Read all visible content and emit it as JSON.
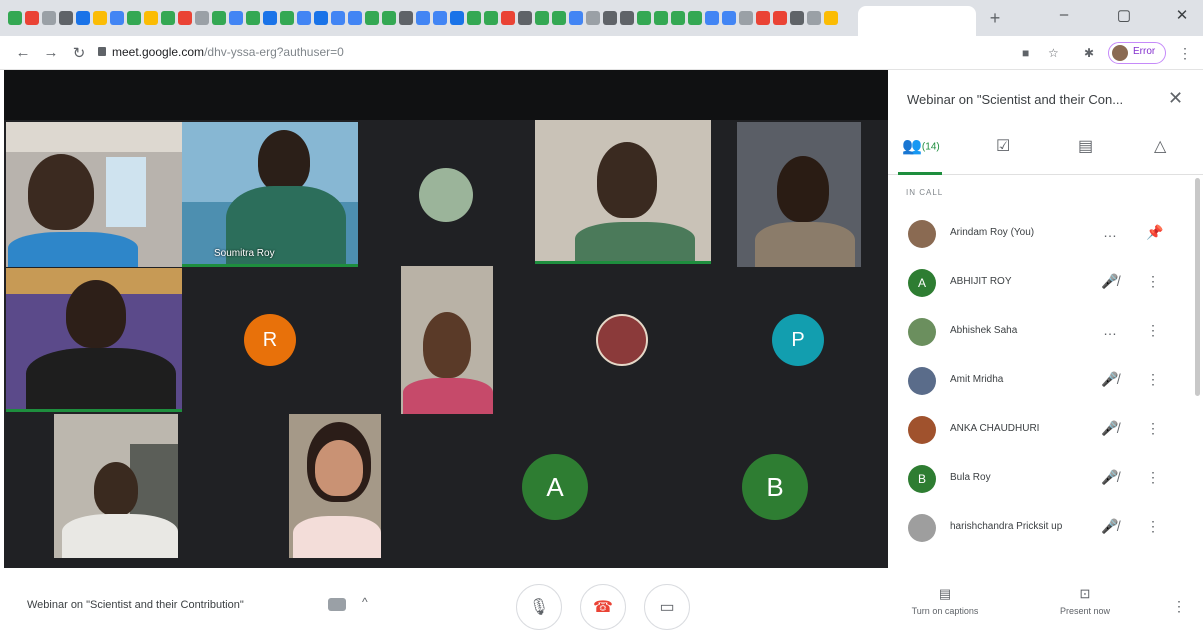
{
  "browser": {
    "tab_icon_colors": [
      "#34a853",
      "#ea4335",
      "#9aa0a6",
      "#5f6368",
      "#1a73e8",
      "#fbbc04",
      "#4285f4",
      "#34a853",
      "#fbbc04",
      "#34a853",
      "#ea4335",
      "#9aa0a6",
      "#34a853",
      "#4285f4",
      "#34a853",
      "#1a73e8",
      "#34a853",
      "#4285f4",
      "#1a73e8",
      "#4285f4",
      "#4285f4",
      "#34a853",
      "#34a853",
      "#5f6368",
      "#4285f4",
      "#4285f4",
      "#1a73e8",
      "#34a853",
      "#34a853",
      "#ea4335",
      "#5f6368",
      "#34a853",
      "#34a853",
      "#4285f4",
      "#9aa0a6",
      "#5f6368",
      "#5f6368",
      "#34a853",
      "#34a853",
      "#34a853",
      "#34a853",
      "#4285f4",
      "#4285f4",
      "#9aa0a6",
      "#ea4335",
      "#ea4335",
      "#5f6368",
      "#9aa0a6",
      "#fbbc04"
    ],
    "new_tab": "+",
    "window_controls": {
      "minimize": "–",
      "maximize": "▢",
      "close": "✕"
    },
    "nav": {
      "back": "←",
      "forward": "→",
      "reload": "↻"
    },
    "url": {
      "host": "meet.google.com",
      "path": "/dhv-yssa-erg?authuser=0"
    },
    "profile_label": "Error",
    "menu": "⋮"
  },
  "participants_tiles": [
    {
      "name": ""
    },
    {
      "name": "Soumitra Roy"
    },
    {
      "name": ""
    },
    {
      "name": ""
    },
    {
      "name": ""
    },
    {
      "name": ""
    },
    {
      "initial": "R",
      "color": "#e8710a"
    },
    {
      "name": ""
    },
    {
      "name": ""
    },
    {
      "initial": "P",
      "color": "#129eaf"
    },
    {
      "name": ""
    },
    {
      "name": ""
    },
    {
      "initial": "A",
      "color": "#2e7d32"
    },
    {
      "initial": "B",
      "color": "#2e7d32"
    }
  ],
  "panel": {
    "title": "Webinar on \"Scientist and their Con...",
    "close": "✕",
    "tabs": {
      "people_count": "(14)"
    },
    "section_label": "IN CALL",
    "people": [
      {
        "name": "Arindam Roy (You)",
        "avatar_color": "#8a6a52",
        "initial": "",
        "mic": "…",
        "action": "📌"
      },
      {
        "name": "ABHIJIT ROY",
        "avatar_color": "#2e7d32",
        "initial": "A",
        "mic": "🎤̸",
        "action": "⋮"
      },
      {
        "name": "Abhishek Saha",
        "avatar_color": "#6b8f5e",
        "initial": "",
        "mic": "…",
        "action": "⋮"
      },
      {
        "name": "Amit Mridha",
        "avatar_color": "#5a6c8a",
        "initial": "",
        "mic": "🎤̸",
        "action": "⋮"
      },
      {
        "name": "ANKA CHAUDHURI",
        "avatar_color": "#a0522d",
        "initial": "",
        "mic": "🎤̸",
        "action": "⋮"
      },
      {
        "name": "Bula Roy",
        "avatar_color": "#2e7d32",
        "initial": "B",
        "mic": "🎤̸",
        "action": "⋮"
      },
      {
        "name": "harishchandra Pricksit up",
        "avatar_color": "#9e9e9e",
        "initial": "",
        "mic": "🎤̸",
        "action": "⋮"
      }
    ]
  },
  "bottom": {
    "meeting_title": "Webinar on \"Scientist and their Contribution\"",
    "caret": "^",
    "captions_label": "Turn on captions",
    "present_label": "Present now",
    "more": "⋮"
  },
  "colors": {
    "hangup_red": "#ea4335",
    "active_green": "#1e8e3e"
  }
}
